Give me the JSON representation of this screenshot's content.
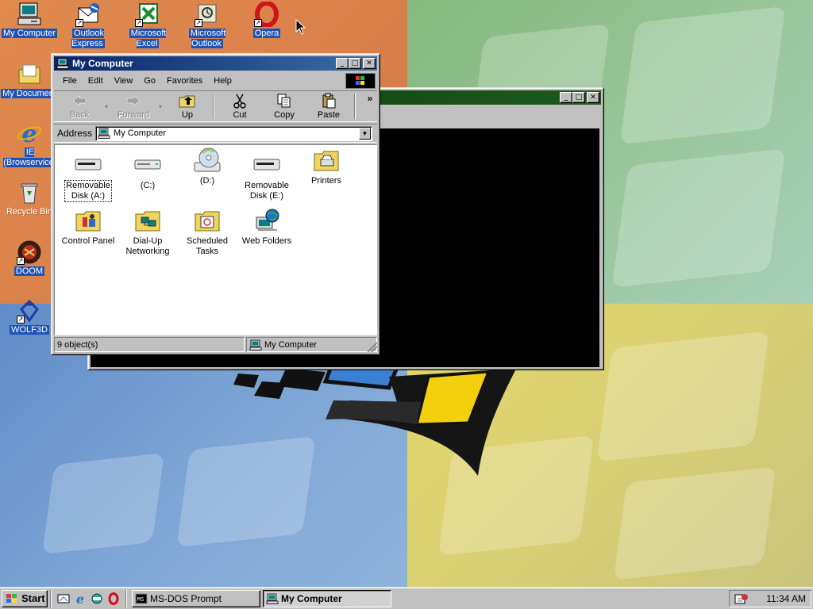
{
  "desktop": {
    "icons": [
      {
        "label": "My Computer",
        "icon": "my-computer-icon"
      },
      {
        "label": "Outlook Express",
        "icon": "outlook-express-icon"
      },
      {
        "label": "Microsoft Excel",
        "icon": "excel-icon"
      },
      {
        "label": "Microsoft Outlook",
        "icon": "outlook-icon"
      },
      {
        "label": "Opera",
        "icon": "opera-icon"
      },
      {
        "label": "My Documents",
        "icon": "folder-icon"
      },
      {
        "label": "IE (Browservice)",
        "icon": "internet-explorer-icon"
      },
      {
        "label": "Recycle Bin",
        "icon": "recycle-bin-icon"
      },
      {
        "label": "DOOM",
        "icon": "doom-icon"
      },
      {
        "label": "WOLF3D",
        "icon": "wolf3d-icon"
      }
    ],
    "visible_labels": {
      "my_documents": "My Document",
      "ie_line1": "IE",
      "ie_line2": "(Browservice",
      "recycle": "Recycle Bin",
      "outlook_express_1": "Outlook",
      "outlook_express_2": "Express",
      "excel_1": "Microsoft",
      "excel_2": "Excel",
      "outlook_1": "Microsoft",
      "outlook_2": "Outlook"
    }
  },
  "dos_window": {
    "title": ""
  },
  "explorer": {
    "title": "My Computer",
    "menu": [
      "File",
      "Edit",
      "View",
      "Go",
      "Favorites",
      "Help"
    ],
    "menu_underline": [
      "F",
      "E",
      "V",
      "G",
      "a",
      "H"
    ],
    "toolbar": {
      "back": "Back",
      "forward": "Forward",
      "up": "Up",
      "cut": "Cut",
      "copy": "Copy",
      "paste": "Paste",
      "more": "»"
    },
    "address_label": "Address",
    "address_value": "My Computer",
    "items": [
      {
        "label1": "Removable",
        "label2": "Disk (A:)",
        "icon": "floppy-drive-icon"
      },
      {
        "label1": "(C:)",
        "label2": "",
        "icon": "hard-drive-icon"
      },
      {
        "label1": "(D:)",
        "label2": "",
        "icon": "cd-drive-icon"
      },
      {
        "label1": "Removable",
        "label2": "Disk (E:)",
        "icon": "removable-drive-icon"
      },
      {
        "label1": "Printers",
        "label2": "",
        "icon": "printers-folder-icon"
      },
      {
        "label1": "Control Panel",
        "label2": "",
        "icon": "control-panel-icon"
      },
      {
        "label1": "Dial-Up",
        "label2": "Networking",
        "icon": "dialup-networking-icon"
      },
      {
        "label1": "Scheduled",
        "label2": "Tasks",
        "icon": "scheduled-tasks-icon"
      },
      {
        "label1": "Web Folders",
        "label2": "",
        "icon": "web-folders-icon"
      }
    ],
    "status_left": "9 object(s)",
    "status_right": "My Computer"
  },
  "taskbar": {
    "start_label": "Start",
    "quick_launch": [
      "desktop-icon",
      "internet-explorer-icon",
      "channels-icon",
      "opera-icon"
    ],
    "tasks": [
      {
        "label": "MS-DOS Prompt",
        "active": false
      },
      {
        "label": "My Computer",
        "active": true
      }
    ],
    "clock": "11:34 AM"
  },
  "colors": {
    "title_active": "#0a246a",
    "title_inactive": "#0b3c0b",
    "face": "#c0c0c0",
    "desktop_label_bg": "#1f53b5"
  }
}
